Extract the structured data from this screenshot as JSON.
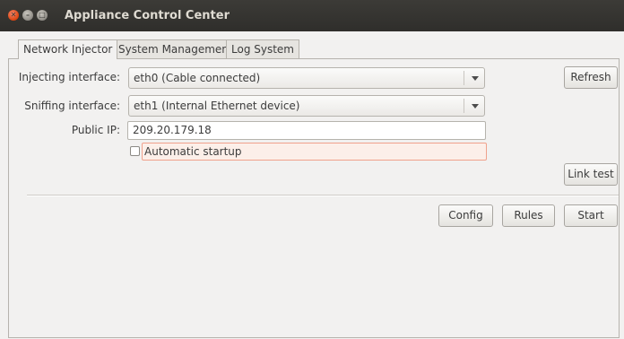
{
  "window": {
    "title": "Appliance Control Center"
  },
  "tabs": [
    {
      "label": "Network Injector",
      "active": true
    },
    {
      "label": "System Management",
      "active": false
    },
    {
      "label": "Log System",
      "active": false
    }
  ],
  "form": {
    "injecting_label": "Injecting interface:",
    "injecting_value": "eth0 (Cable connected)",
    "sniffing_label": "Sniffing interface:",
    "sniffing_value": "eth1 (Internal Ethernet device)",
    "public_ip_label": "Public IP:",
    "public_ip_value": "209.20.179.18",
    "auto_startup_label": "Automatic startup",
    "auto_startup_checked": false
  },
  "buttons": {
    "refresh": "Refresh",
    "link_test": "Link test",
    "config": "Config",
    "rules": "Rules",
    "start": "Start"
  },
  "icons": [
    "close-icon",
    "minimize-icon",
    "maximize-icon",
    "chevron-down-icon"
  ]
}
